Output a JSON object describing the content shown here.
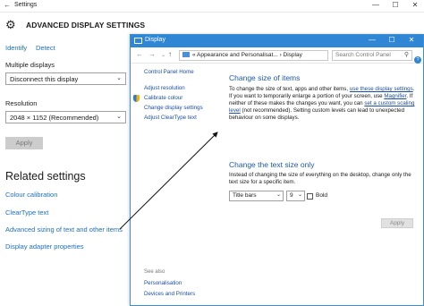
{
  "settings": {
    "title": "Settings",
    "heading": "ADVANCED DISPLAY SETTINGS",
    "top_links": [
      "Identify",
      "Detect"
    ],
    "multiple_displays_label": "Multiple displays",
    "multiple_displays_value": "Disconnect this display",
    "resolution_label": "Resolution",
    "resolution_value": "2048 × 1152 (Recommended)",
    "apply_label": "Apply",
    "related_heading": "Related settings",
    "related_links": [
      "Colour calibration",
      "ClearType text",
      "Advanced sizing of text and other items",
      "Display adapter properties"
    ]
  },
  "display": {
    "title": "Display",
    "address": "«  Appearance and Personalisat...  ›  Display",
    "search_placeholder": "Search Control Panel",
    "sidebar": {
      "home": "Control Panel Home",
      "links": [
        "Adjust resolution",
        "Calibrate colour",
        "Change display settings",
        "Adjust ClearType text"
      ],
      "see_also": "See also",
      "see_also_links": [
        "Personalisation",
        "Devices and Printers"
      ]
    },
    "main": {
      "heading1": "Change size of items",
      "para1_a": "To change the size of text, apps and other items, ",
      "para1_link1": "use these display settings",
      "para1_b": ". If you want to temporarily enlarge a portion of your screen, use ",
      "para1_link2": "Magnifier",
      "para1_c": ". If neither of these makes the changes you want, you can ",
      "para1_link3": "set a custom scaling level",
      "para1_d": " (not recommended). Setting custom levels can lead to unexpected behaviour on some displays.",
      "heading2": "Change the text size only",
      "para2": "Instead of changing the size of everything on the desktop, change only the text size for a specific item.",
      "item_dropdown": "Title bars",
      "size_dropdown": "9",
      "bold_label": "Bold",
      "apply_label": "Apply"
    }
  },
  "icons": {
    "back": "←",
    "minimize": "—",
    "maximize": "☐",
    "close": "✕",
    "gear": "⚙",
    "chevron": "⌄",
    "nav_back": "←",
    "nav_forward": "→",
    "nav_up": "↑",
    "refresh": "↻",
    "search": "⚲",
    "help": "?"
  },
  "colors": {
    "link": "#1c6fc2",
    "titlebar": "#2f86d4",
    "heading_blue": "#1e5aa8"
  }
}
